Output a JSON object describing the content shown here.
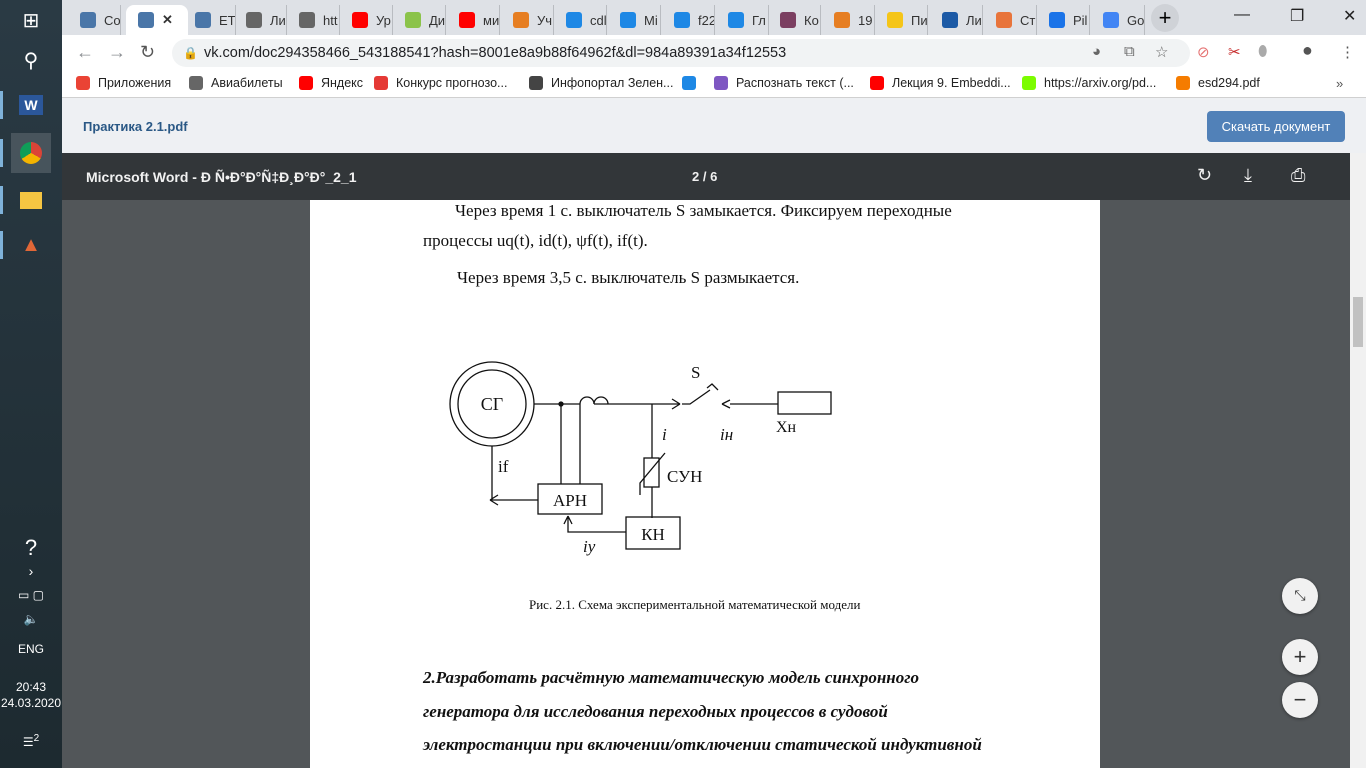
{
  "taskbar": {
    "time": "20:43",
    "date": "24.03.2020",
    "lang": "ENG",
    "notifications": "2"
  },
  "tabs": [
    {
      "label": "Co",
      "color": "#4a76a8"
    },
    {
      "label": "",
      "color": "#4a76a8"
    },
    {
      "label": "ETI",
      "color": "#4a76a8"
    },
    {
      "label": "Ли",
      "color": "#666"
    },
    {
      "label": "htt",
      "color": "#666"
    },
    {
      "label": "Ур",
      "color": "#f00"
    },
    {
      "label": "Ди",
      "color": "#8bc34a"
    },
    {
      "label": "ми",
      "color": "#f00"
    },
    {
      "label": "Уч",
      "color": "#e67e22"
    },
    {
      "label": "cdl",
      "color": "#1e88e5"
    },
    {
      "label": "Mi",
      "color": "#1e88e5"
    },
    {
      "label": "f22",
      "color": "#1e88e5"
    },
    {
      "label": "Гл",
      "color": "#1e88e5"
    },
    {
      "label": "Ко",
      "color": "#7b3f61"
    },
    {
      "label": "19",
      "color": "#e67e22"
    },
    {
      "label": "Пи",
      "color": "#f5c518"
    },
    {
      "label": "Ли",
      "color": "#1c5aa6"
    },
    {
      "label": "Ст",
      "color": "#e8743b"
    },
    {
      "label": "Pil",
      "color": "#1a73e8"
    },
    {
      "label": "Go",
      "color": "#4285f4"
    }
  ],
  "active_tab_close": "✕",
  "url": "vk.com/doc294358466_543188541?hash=8001e8a9b88f64962f&dl=984a89391a34f12553",
  "bookmarks": [
    {
      "label": "Приложения",
      "color": "#ea4335"
    },
    {
      "label": "Авиабилеты",
      "color": "#666"
    },
    {
      "label": "Яндекс",
      "color": "#f00"
    },
    {
      "label": "Конкурс прогнозо...",
      "color": "#e53935"
    },
    {
      "label": "Инфопортал Зелен...",
      "color": "#444"
    },
    {
      "label": "",
      "color": "#1e88e5"
    },
    {
      "label": "Распознать текст (...",
      "color": "#7e57c2"
    },
    {
      "label": "Лекция 9. Embeddi...",
      "color": "#f00"
    },
    {
      "label": "https://arxiv.org/pd...",
      "color": "#7cfc00"
    },
    {
      "label": "esd294.pdf",
      "color": "#f57c00"
    }
  ],
  "pdf": {
    "filename": "Практика 2.1.pdf",
    "download_label": "Скачать документ",
    "viewer_title": "Microsoft Word - Ð Ñ•Ð°Ð°Ñ‡Ð¸Ð°Ð°_2_1",
    "page_indicator": "2 / 6"
  },
  "document": {
    "para1_line1": "Через  время  1  с.  выключатель  S  замыкается.  Фиксируем  переходные",
    "para1_line2": "процессы uq(t), id(t), ψf(t), if(t).",
    "para2": "Через время 3,5 с. выключатель S размыкается.",
    "caption": "Рис. 2.1. Схема экспериментальной математической модели",
    "heading_lines": [
      "2.Разработать расчётную  математическую модель  синхронного",
      "генератора  для исследования переходных процессов  в судовой",
      "электростанции  при включении/отключении статической индуктивной"
    ]
  },
  "diagram": {
    "generator": "СГ",
    "switch": "S",
    "load": "Xн",
    "current_i": "i",
    "current_load": "iн",
    "current_field": "if",
    "arn": "АРН",
    "sun": "СУН",
    "kn": "КН",
    "current_control": "iу"
  }
}
